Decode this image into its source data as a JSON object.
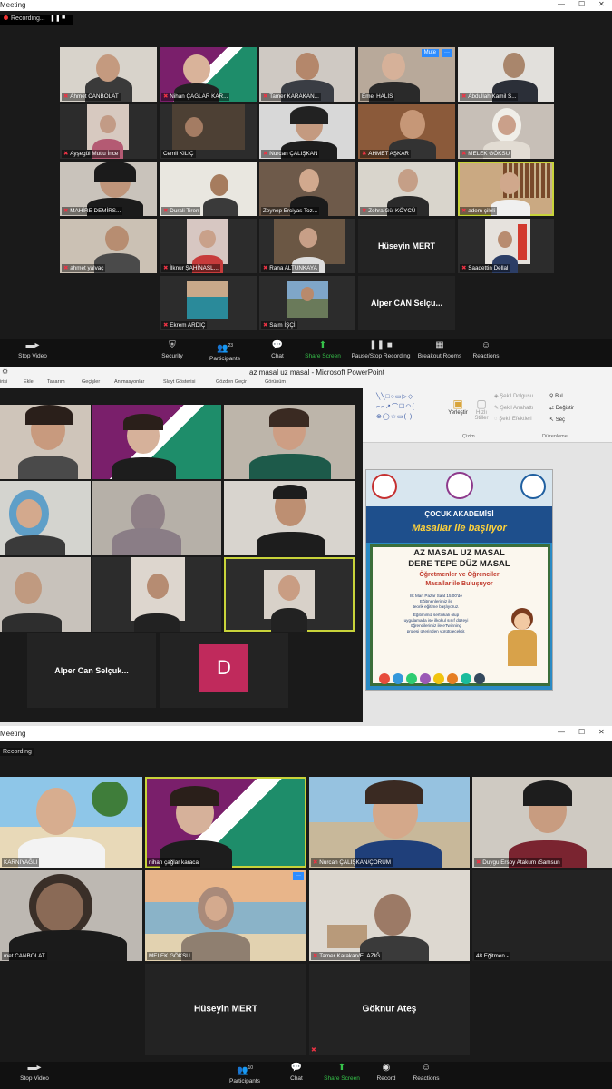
{
  "panel1": {
    "window_title": "Meeting",
    "recording_label": "Recording...",
    "tiles": [
      {
        "name": "Ahmet CANBOLAT"
      },
      {
        "name": "Nihan ÇAĞLAR KAR..."
      },
      {
        "name": "Tamer KARAKAN..."
      },
      {
        "name": "Emel HALİS",
        "badge": "Mute"
      },
      {
        "name": "Abdullah Kamil S..."
      },
      {
        "name": "Ayşegül Mutlu İnce"
      },
      {
        "name": "Cemil KILIÇ"
      },
      {
        "name": "Nurcan ÇALIŞKAN"
      },
      {
        "name": "AHMET AŞKAR"
      },
      {
        "name": "MELEK GÖKSU"
      },
      {
        "name": "MAHİRE DEMİRS..."
      },
      {
        "name": "Durali Tiren"
      },
      {
        "name": "Zeynep Erciyas Toz..."
      },
      {
        "name": "Zehra Gül KÖYCÜ"
      },
      {
        "name": "adem çileli"
      },
      {
        "name": "ahmet yalvaç"
      },
      {
        "name": "İlknur ŞAHİNASL..."
      },
      {
        "name": "Rana ALTUNKAYA"
      },
      {
        "name": "Hüseyin MERT"
      },
      {
        "name": "Saadettin Dellal"
      },
      {
        "name": "Ekrem ARDIÇ"
      },
      {
        "name": "Saim İŞÇİ"
      },
      {
        "name": "Alper CAN Selçu..."
      }
    ],
    "toolbar": {
      "stop_video": "Stop Video",
      "security": "Security",
      "participants": "Participants",
      "participants_count": "23",
      "chat": "Chat",
      "share_screen": "Share Screen",
      "pause_recording": "Pause/Stop Recording",
      "breakout_rooms": "Breakout Rooms",
      "reactions": "Reactions"
    }
  },
  "panel2": {
    "window_title": "az masal uz masal - Microsoft PowerPoint",
    "tabs": [
      "irişi",
      "Ekle",
      "Tasarım",
      "Geçişler",
      "Animasyonlar",
      "Slayt Gösterisi",
      "Gözden Geçir",
      "Görünüm"
    ],
    "ribbon": {
      "yerlestir": "Yerleştir",
      "hizli_stiller": "Hızlı Stiller",
      "sekil_dolgusu": "Şekil Dolgusu",
      "sekil_anahatti": "Şekil Anahattı",
      "sekil_efektleri": "Şekil Efektleri",
      "bul": "Bul",
      "degistir": "Değiştir",
      "sec": "Seç",
      "cizim": "Çizim",
      "duzenleme": "Düzenleme"
    },
    "tiles": [
      {
        "name": "Alper Can Selçuk..."
      },
      {
        "name": "D"
      }
    ],
    "slide": {
      "header1": "ÇOCUK AKADEMİSİ",
      "header2": "Masallar ile başlıyor",
      "line1": "AZ MASAL UZ MASAL",
      "line2": "DERE TEPE DÜZ MASAL",
      "line3": "Öğretmenler ve Öğrenciler",
      "line4": "Masallar ile Buluşuyor",
      "body1": "İlk Mart Pazar Saat 15.00'de",
      "body2": "Eğitmenlerimiz ile",
      "body3": "teorik eğitime başlıyoruz.",
      "body4": "Eğitimimiz sertifikalı olup",
      "body5": "uygulamada ise ilkokul sınıf düzeyi",
      "body6": "öğrencilerimiz ile eTwinning",
      "body7": "projesi üzerinden yürütülecektir."
    }
  },
  "panel3": {
    "window_title": "Meeting",
    "recording_label": "Recording",
    "tiles": [
      {
        "name": "KARNIYAĞLI"
      },
      {
        "name": "nihan çağlar karaca"
      },
      {
        "name": "Nurcan ÇALIŞKAN/ÇORUM"
      },
      {
        "name": "Duygu Ersoy Atakum /Samsun"
      },
      {
        "name": "met CANBOLAT"
      },
      {
        "name": "MELEK GÖKSU"
      },
      {
        "name": "Tamer Karakan/ELAZIĞ"
      },
      {
        "name": "48 Eğitmen -"
      },
      {
        "name": "Hüseyin MERT"
      },
      {
        "name": "Göknur Ateş"
      }
    ],
    "toolbar": {
      "stop_video": "Stop Video",
      "participants": "Participants",
      "participants_count": "10",
      "chat": "Chat",
      "share_screen": "Share Screen",
      "record": "Record",
      "reactions": "Reactions"
    }
  },
  "colors": {
    "zoom_bg": "#1a1a1a",
    "zoom_green": "#36c24a",
    "active_speaker": "#c8d33a",
    "logo_purple": "#7a1f6b",
    "logo_teal": "#1e8d6a"
  }
}
